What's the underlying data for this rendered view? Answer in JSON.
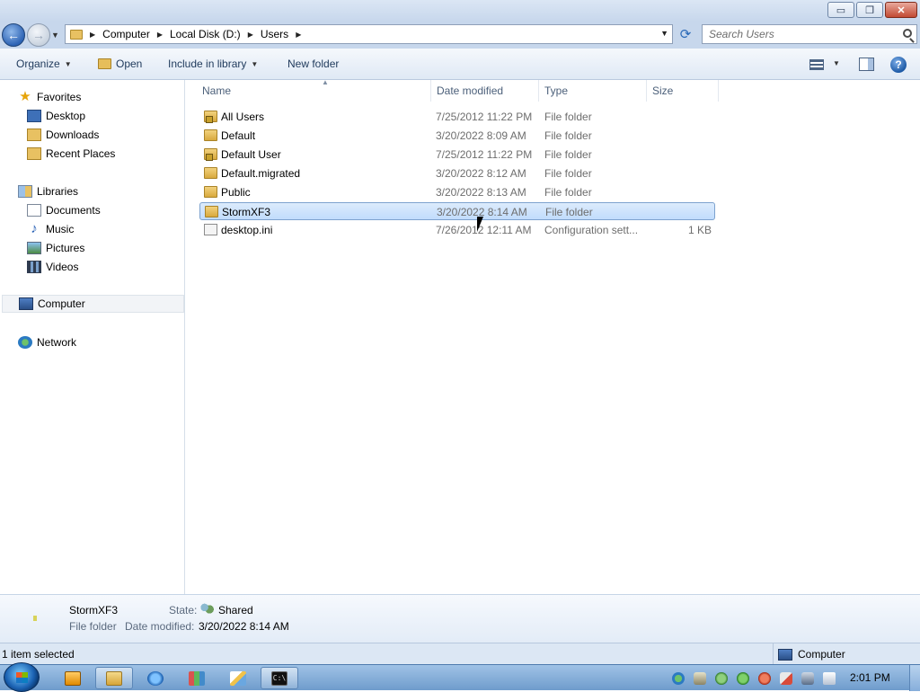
{
  "window": {
    "min_symbol": "▭",
    "max_symbol": "❐",
    "close_symbol": "✕"
  },
  "address": {
    "back_symbol": "←",
    "forward_symbol": "→",
    "crumbs": [
      "Computer",
      "Local Disk (D:)",
      "Users"
    ],
    "refresh_symbol": "⟳"
  },
  "search": {
    "placeholder": "Search Users"
  },
  "toolbar": {
    "organize": "Organize",
    "open": "Open",
    "include": "Include in library",
    "new_folder": "New folder",
    "help": "?"
  },
  "nav": {
    "favorites": "Favorites",
    "desktop": "Desktop",
    "downloads": "Downloads",
    "recent": "Recent Places",
    "libraries": "Libraries",
    "documents": "Documents",
    "music": "Music",
    "pictures": "Pictures",
    "videos": "Videos",
    "computer": "Computer",
    "network": "Network"
  },
  "columns": {
    "name": "Name",
    "date": "Date modified",
    "type": "Type",
    "size": "Size"
  },
  "files": [
    {
      "name": "All Users",
      "date": "7/25/2012 11:22 PM",
      "type": "File folder",
      "size": ""
    },
    {
      "name": "Default",
      "date": "3/20/2022 8:09 AM",
      "type": "File folder",
      "size": ""
    },
    {
      "name": "Default User",
      "date": "7/25/2012 11:22 PM",
      "type": "File folder",
      "size": ""
    },
    {
      "name": "Default.migrated",
      "date": "3/20/2022 8:12 AM",
      "type": "File folder",
      "size": ""
    },
    {
      "name": "Public",
      "date": "3/20/2022 8:13 AM",
      "type": "File folder",
      "size": ""
    },
    {
      "name": "StormXF3",
      "date": "3/20/2022 8:14 AM",
      "type": "File folder",
      "size": ""
    },
    {
      "name": "desktop.ini",
      "date": "7/26/2012 12:11 AM",
      "type": "Configuration sett...",
      "size": "1 KB"
    }
  ],
  "details": {
    "name": "StormXF3",
    "type": "File folder",
    "state_label": "State:",
    "state_value": "Shared",
    "date_label": "Date modified:",
    "date_value": "3/20/2022 8:14 AM"
  },
  "status": {
    "selected": "1 item selected",
    "location": "Computer"
  },
  "taskbar": {
    "clock": "2:01 PM",
    "cmd_label": "C:\\"
  }
}
